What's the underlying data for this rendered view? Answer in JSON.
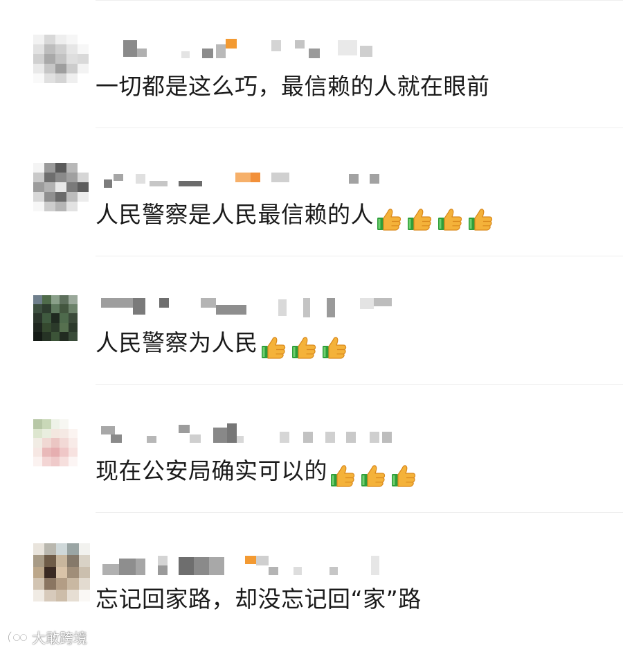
{
  "comments": [
    {
      "text": "一切都是这么巧，最信赖的人就在眼前",
      "thumbs_up_count": 0
    },
    {
      "text": "人民警察是人民最信赖的人",
      "thumbs_up_count": 4
    },
    {
      "text": "人民警察为人民",
      "thumbs_up_count": 3
    },
    {
      "text": "现在公安局确实可以的",
      "thumbs_up_count": 3
    },
    {
      "text": "忘记回家路，却没忘记回“家”路",
      "thumbs_up_count": 0
    }
  ],
  "icons": {
    "thumbs_up": "thumbs-up-icon"
  },
  "colors": {
    "text": "#1a1a1a",
    "divider": "#eeeeee",
    "thumb_yellow": "#f4b23a",
    "thumb_cuff": "#2f9e3a"
  },
  "watermark": {
    "text": "大敢跨境"
  }
}
